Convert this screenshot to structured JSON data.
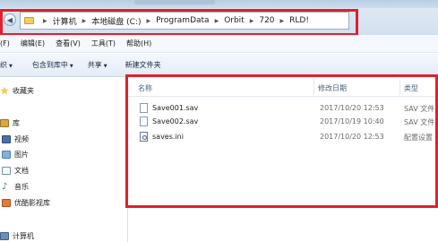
{
  "address_bar": {
    "breadcrumbs": [
      "计算机",
      "本地磁盘 (C:)",
      "ProgramData",
      "Orbit",
      "720",
      "RLD!"
    ]
  },
  "menu": {
    "items": [
      "(F)",
      "编辑(E)",
      "查看(V)",
      "工具(T)",
      "帮助(H)"
    ]
  },
  "toolbar": {
    "organize": "织",
    "include_in_library": "包含到库中",
    "share": "共享",
    "new_folder": "新建文件夹"
  },
  "nav": {
    "favorites": "收藏夹",
    "libraries": "库",
    "videos": "视频",
    "pictures": "图片",
    "documents": "文档",
    "music": "音乐",
    "youku": "优酷影视库",
    "computer": "计算机"
  },
  "columns": {
    "name": "名称",
    "modified": "修改日期",
    "type": "类型"
  },
  "files": [
    {
      "name": "Save001.sav",
      "modified": "2017/10/20 12:53",
      "type": "SAV 文件",
      "icon": "document-icon"
    },
    {
      "name": "Save002.sav",
      "modified": "2017/10/19 10:40",
      "type": "SAV 文件",
      "icon": "document-icon"
    },
    {
      "name": "saves.ini",
      "modified": "2017/10/20 12:53",
      "type": "配置设置",
      "icon": "settings-file-icon"
    }
  ],
  "colors": {
    "highlight_red": "#e0202a",
    "folder_yellow": "#f3cf5f"
  }
}
